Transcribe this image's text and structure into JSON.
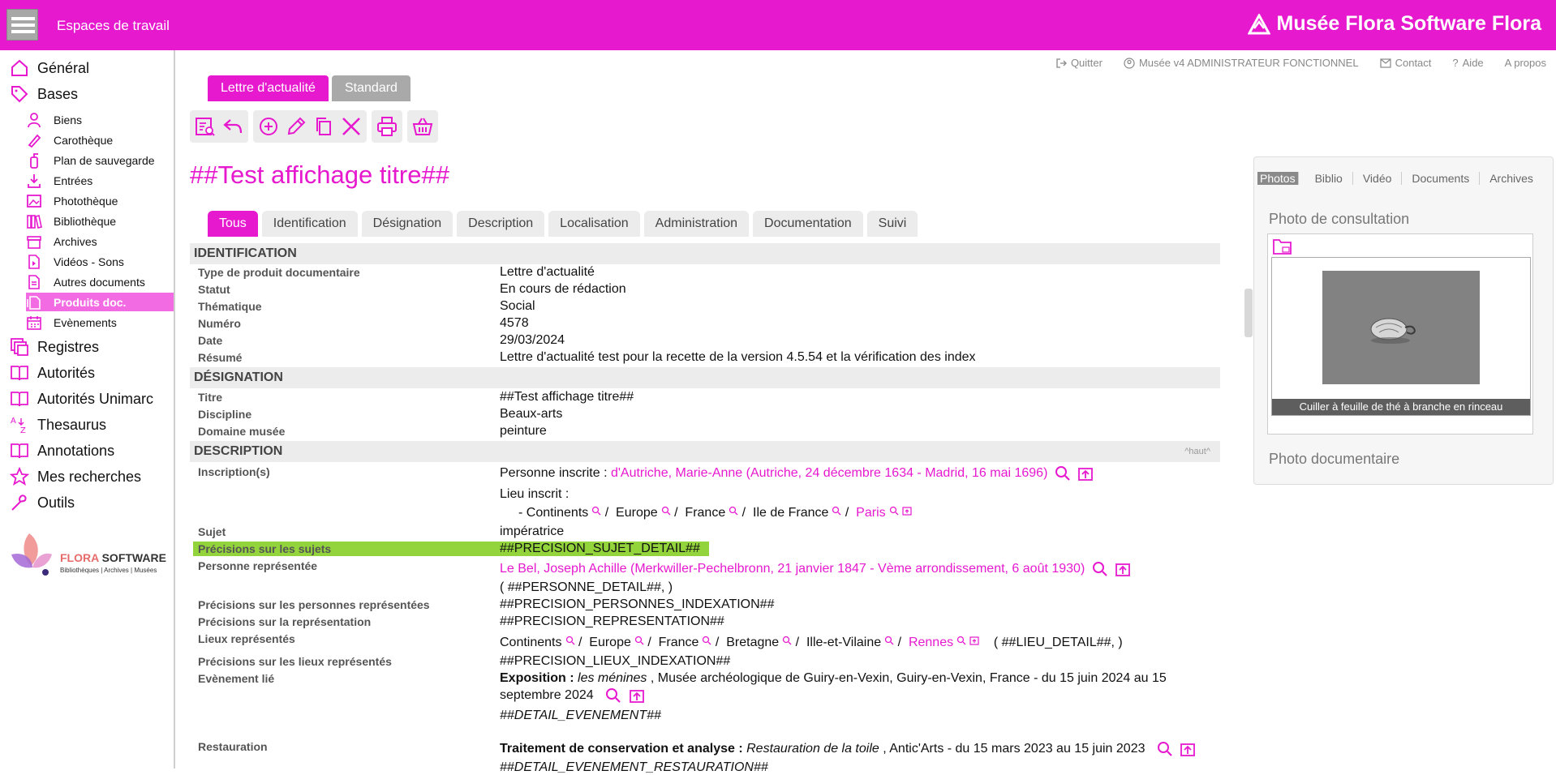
{
  "header": {
    "workspace_title": "Espaces de travail",
    "brand": "Musée Flora Software Flora",
    "bg_color": "#e619cf"
  },
  "sidebar": {
    "main_items": [
      {
        "label": "Général",
        "icon": "home-icon"
      },
      {
        "label": "Bases",
        "icon": "tag-icon"
      },
      {
        "label": "Registres",
        "icon": "stack-icon"
      },
      {
        "label": "Autorités",
        "icon": "book-icon"
      },
      {
        "label": "Autorités Unimarc",
        "icon": "book-icon"
      },
      {
        "label": "Thesaurus",
        "icon": "az-icon"
      },
      {
        "label": "Annotations",
        "icon": "book-icon"
      },
      {
        "label": "Mes recherches",
        "icon": "star-icon"
      },
      {
        "label": "Outils",
        "icon": "wrench-icon"
      }
    ],
    "sub_items": [
      {
        "label": "Biens",
        "icon": "person-icon"
      },
      {
        "label": "Carothèque",
        "icon": "pen-icon"
      },
      {
        "label": "Plan de sauvegarde",
        "icon": "extinguisher-icon"
      },
      {
        "label": "Entrées",
        "icon": "download-icon"
      },
      {
        "label": "Photothèque",
        "icon": "image-icon"
      },
      {
        "label": "Bibliothèque",
        "icon": "books-icon"
      },
      {
        "label": "Archives",
        "icon": "box-icon"
      },
      {
        "label": "Vidéos - Sons",
        "icon": "video-icon"
      },
      {
        "label": "Autres documents",
        "icon": "document-icon"
      },
      {
        "label": "Produits doc.",
        "icon": "docs-icon",
        "active": true
      },
      {
        "label": "Evènements",
        "icon": "calendar-icon"
      }
    ],
    "logo": {
      "brand_a": "FLORA",
      "brand_b": "SOFTWARE",
      "tagline": "Bibliothèques | Archives | Musées"
    }
  },
  "top_links": {
    "quit": "Quitter",
    "user": "Musée v4 ADMINISTRATEUR FONCTIONNEL",
    "contact": "Contact",
    "help": "Aide",
    "about": "A propos"
  },
  "doc_tabs": {
    "active": "Lettre d'actualité",
    "other": "Standard"
  },
  "page_title": "##Test affichage titre##",
  "tabs": [
    "Tous",
    "Identification",
    "Désignation",
    "Description",
    "Localisation",
    "Administration",
    "Documentation",
    "Suivi"
  ],
  "sections": {
    "identification": "IDENTIFICATION",
    "designation": "DÉSIGNATION",
    "description": "DESCRIPTION",
    "haut": "^haut^"
  },
  "identification": {
    "type_label": "Type de produit documentaire",
    "type_value": "Lettre d'actualité",
    "statut_label": "Statut",
    "statut_value": "En cours de rédaction",
    "thematique_label": "Thématique",
    "thematique_value": "Social",
    "numero_label": "Numéro",
    "numero_value": "4578",
    "date_label": "Date",
    "date_value": "29/03/2024",
    "resume_label": "Résumé",
    "resume_value": "Lettre d'actualité test pour la recette de la version 4.5.54 et la vérification des index"
  },
  "designation": {
    "titre_label": "Titre",
    "titre_value": "##Test affichage titre##",
    "discipline_label": "Discipline",
    "discipline_value": "Beaux-arts",
    "domaine_label": "Domaine musée",
    "domaine_value": "peinture"
  },
  "description": {
    "inscriptions_label": "Inscription(s)",
    "personne_inscrite_prefix": "Personne inscrite : ",
    "personne_inscrite_value": "d'Autriche, Marie-Anne (Autriche, 24 décembre 1634 - Madrid, 16 mai 1696)",
    "lieu_inscrit_label": "Lieu inscrit :",
    "lieu_path": [
      "-  Continents",
      "Europe",
      "France",
      "Ile de France"
    ],
    "lieu_final": "Paris",
    "sujet_label": "Sujet",
    "sujet_value": "impératrice",
    "precisions_sujets_label": "Précisions sur les sujets",
    "precisions_sujets_value": "##PRECISION_SUJET_DETAIL##",
    "personne_rep_label": "Personne représentée",
    "personne_rep_value": "Le Bel, Joseph Achille (Merkwiller-Pechelbronn, 21 janvier 1847 - Vème arrondissement, 6 août 1930)",
    "personne_detail": "( ##PERSONNE_DETAIL##, )",
    "precisions_personnes_label": "Précisions sur les personnes représentées",
    "precisions_personnes_value": "##PRECISION_PERSONNES_INDEXATION##",
    "precisions_rep_label": "Précisions sur la représentation",
    "precisions_rep_value": "##PRECISION_REPRESENTATION##",
    "lieux_rep_label": "Lieux représentés",
    "lieux_path": [
      "Continents",
      "Europe",
      "France",
      "Bretagne",
      "Ille-et-Vilaine"
    ],
    "lieux_final": "Rennes",
    "lieu_detail": "( ##LIEU_DETAIL##, )",
    "precisions_lieux_label": "Précisions sur les lieux représentés",
    "precisions_lieux_value": "##PRECISION_LIEUX_INDEXATION##",
    "evenement_label": "Evènement lié",
    "evenement_bold": "Exposition :",
    "evenement_italic": "les ménines",
    "evenement_rest": ",  Musée archéologique de Guiry-en-Vexin, Guiry-en-Vexin, France - du 15 juin 2024 au 15",
    "evenement_line2": "septembre 2024",
    "evenement_detail": "##DETAIL_EVENEMENT##",
    "restauration_label": "Restauration",
    "restauration_bold": "Traitement de conservation et analyse :",
    "restauration_italic": "Restauration de la toile",
    "restauration_rest": ",  Antic'Arts - du 15 mars 2023 au 15 juin 2023",
    "restauration_detail": "##DETAIL_EVENEMENT_RESTAURATION##"
  },
  "right_panel": {
    "tabs": [
      "Photos",
      "Biblio",
      "Vidéo",
      "Documents",
      "Archives"
    ],
    "photo_consultation": "Photo de consultation",
    "caption": "Cuiller à feuille de thé à branche en rinceau",
    "photo_documentaire": "Photo documentaire"
  }
}
